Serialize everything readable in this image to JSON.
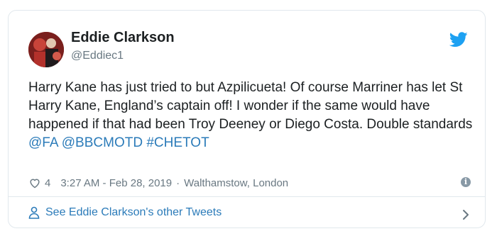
{
  "author": {
    "name": "Eddie Clarkson",
    "handle": "@Eddiec1"
  },
  "tweet": {
    "text_plain": "Harry Kane has just tried to but Azpilicueta! Of course Marriner has let St Harry Kane, England’s captain off! I wonder if the same would have happened if that had been Troy Deeney or Diego Costa. Double standards ",
    "mentions": [
      "@FA",
      "@BBCMOTD",
      "#CHETOT"
    ]
  },
  "meta": {
    "like_count": "4",
    "time": "3:27 AM - Feb 28, 2019",
    "separator": "·",
    "location": "Walthamstow, London"
  },
  "footer": {
    "link_label": "See Eddie Clarkson's other Tweets"
  },
  "icons": {
    "brand": "twitter-bird-icon",
    "like": "heart-icon",
    "info": "info-icon",
    "profile": "person-icon",
    "chevron": "chevron-right-icon"
  },
  "colors": {
    "brand_blue": "#1da1f2",
    "link_blue": "#2b7bb9",
    "muted": "#697882",
    "text": "#1c2022",
    "border": "#e1e8ed"
  }
}
